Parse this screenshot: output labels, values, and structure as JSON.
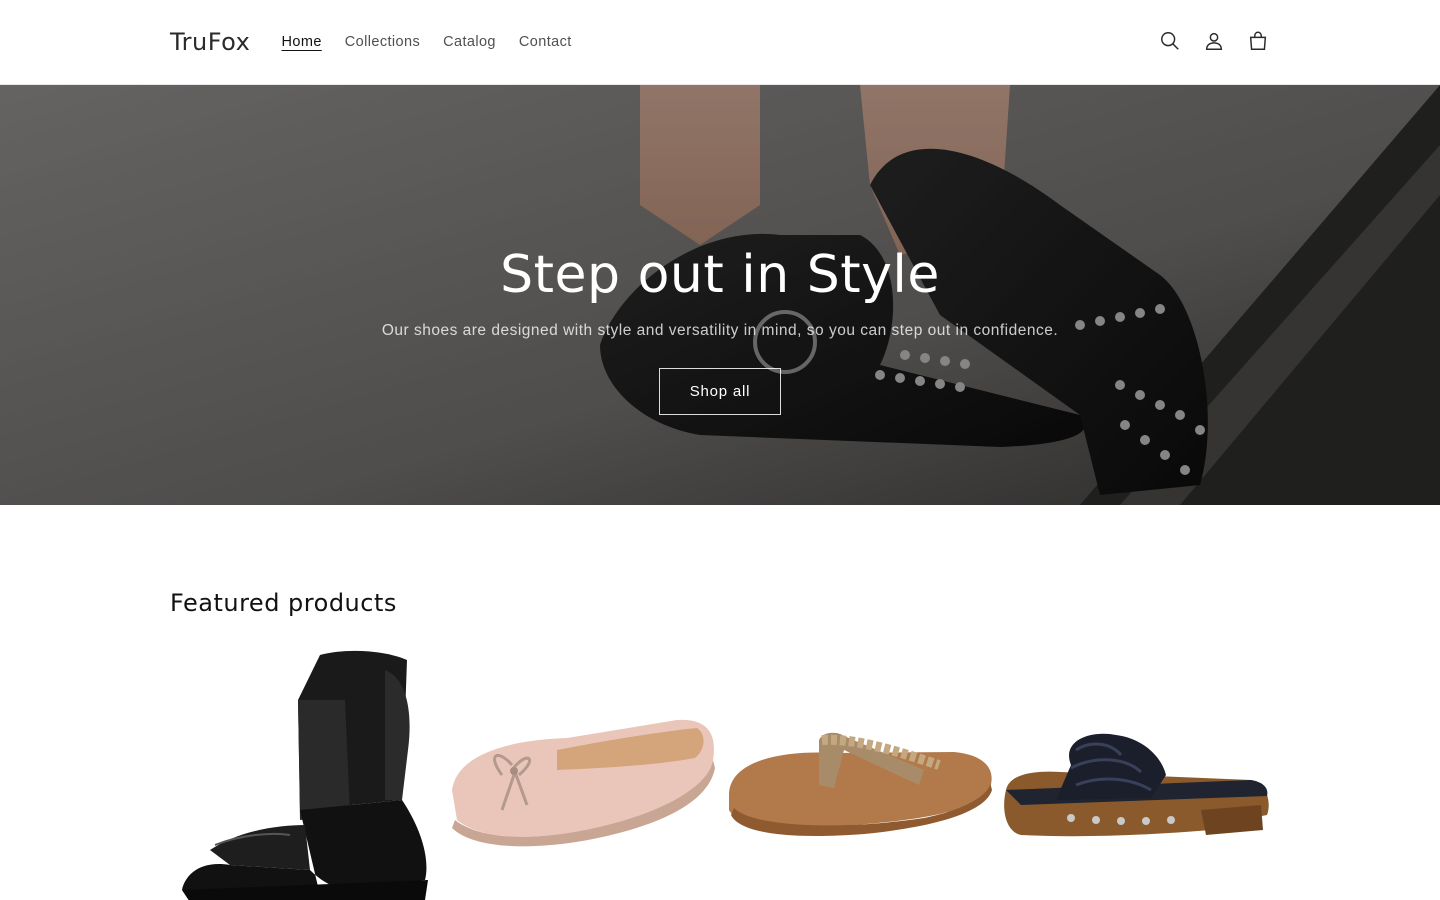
{
  "header": {
    "logo": "TruFox",
    "nav": [
      {
        "label": "Home",
        "active": true
      },
      {
        "label": "Collections",
        "active": false
      },
      {
        "label": "Catalog",
        "active": false
      },
      {
        "label": "Contact",
        "active": false
      }
    ],
    "icons": [
      "search-icon",
      "account-icon",
      "cart-icon"
    ]
  },
  "hero": {
    "title": "Step out in Style",
    "subtitle": "Our shoes are designed with style and versatility in mind, so you can step out in confidence.",
    "button_label": "Shop all"
  },
  "featured": {
    "title": "Featured products",
    "products": [
      {
        "image": "black-chelsea-boot"
      },
      {
        "image": "pink-ballet-flat"
      },
      {
        "image": "tan-braided-flip-flop"
      },
      {
        "image": "navy-woven-clog-sandal"
      }
    ]
  }
}
